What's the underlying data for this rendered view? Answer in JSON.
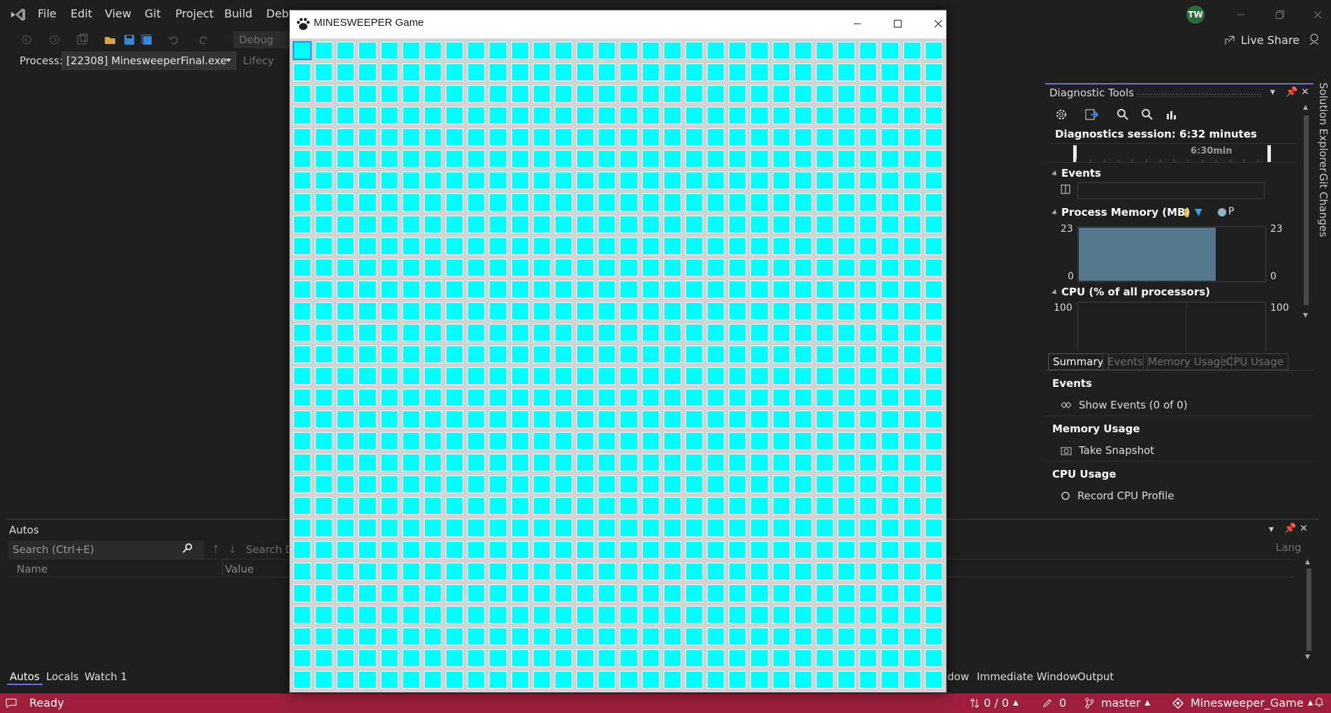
{
  "menu": {
    "items": [
      "File",
      "Edit",
      "View",
      "Git",
      "Project",
      "Build",
      "Debu"
    ]
  },
  "user": {
    "initials": "TW"
  },
  "toolbar": {
    "config": "Debug",
    "live_share": "Live Share"
  },
  "process": {
    "label": "Process:",
    "value": "[22308] MinesweeperFinal.exe",
    "lifecycle": "Lifecy"
  },
  "diagnostics": {
    "title": "Diagnostic Tools",
    "session": "Diagnostics session: 6:32 minutes",
    "time_mark": "6:30min",
    "events_head": "Events",
    "memory_head": "Process Memory (MB)",
    "memory_legend_p": "P",
    "memory_axis": {
      "max": "23",
      "min": "0"
    },
    "memory_fill_fraction": 0.73,
    "cpu_head": "CPU (% of all processors)",
    "cpu_axis": {
      "max": "100"
    },
    "tabs": [
      "Summary",
      "Events",
      "Memory Usage",
      "CPU Usage"
    ],
    "summary": {
      "events_head": "Events",
      "show_events": "Show Events (0 of 0)",
      "memory_head": "Memory Usage",
      "take_snapshot": "Take Snapshot",
      "cpu_head": "CPU Usage",
      "record_cpu": "Record CPU Profile"
    }
  },
  "side_tabs": [
    "Solution Explorer",
    "Git Changes"
  ],
  "autos": {
    "title": "Autos",
    "search_placeholder": "Search (Ctrl+E)",
    "search_depth": "Search D",
    "col_name": "Name",
    "col_value": "Value",
    "col_lang": "Lang"
  },
  "bottom_tabs_left": [
    "Autos",
    "Locals",
    "Watch 1"
  ],
  "bottom_tabs_right": [
    "dow",
    "Immediate Window",
    "Output"
  ],
  "status": {
    "ready": "Ready",
    "lines": "0 / 0",
    "pending": "0",
    "branch": "master",
    "repo": "Minesweeper_Game"
  },
  "game": {
    "title": "MINESWEEPER Game",
    "rows": 30,
    "cols": 30,
    "cell_color": "#00ffff",
    "selected_cell": 0
  }
}
